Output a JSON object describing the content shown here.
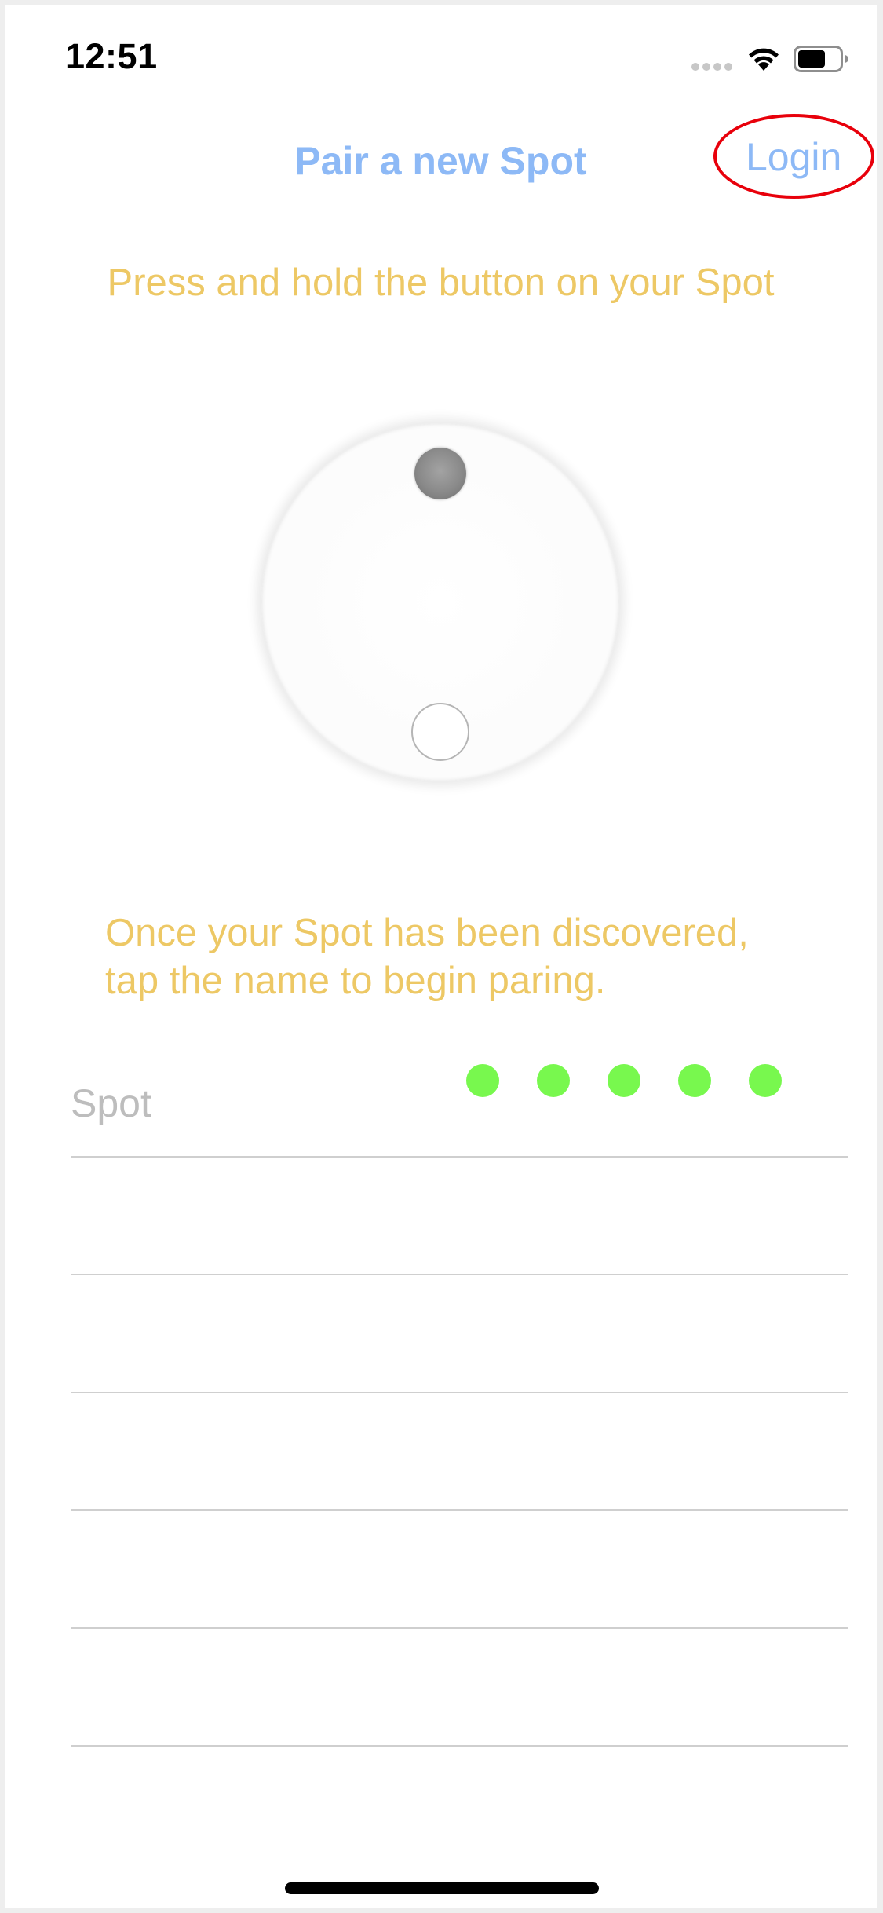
{
  "theme": {
    "title_color": "#8DB9F6",
    "text_color": "#EDC865",
    "dot_color": "#78F84E",
    "annotation_color": "#E8000B"
  },
  "status_bar": {
    "time": "12:51",
    "signal_icon": "cellular-signal-icon",
    "wifi_icon": "wifi-icon",
    "battery_icon": "battery-icon"
  },
  "nav": {
    "title": "Pair a new Spot",
    "login_label": "Login"
  },
  "instruction": "Press and hold the button on your Spot",
  "device_image": {
    "led_icon": "led-indicator-icon",
    "button_icon": "device-button-icon"
  },
  "discover_text": {
    "line1": "Once your Spot has been discovered,",
    "line2": "tap the name to begin paring."
  },
  "devices": [
    {
      "name": "Spot",
      "signal_dots": 5
    }
  ],
  "empty_rows": 5
}
